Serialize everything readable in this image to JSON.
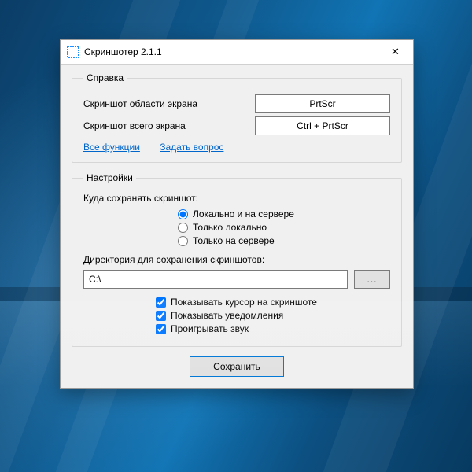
{
  "window": {
    "title": "Скриншотер 2.1.1"
  },
  "help": {
    "legend": "Справка",
    "area_label": "Скриншот области экрана",
    "area_hotkey": "PrtScr",
    "full_label": "Скриншот всего экрана",
    "full_hotkey": "Ctrl + PrtScr",
    "link_all": "Все функции",
    "link_ask": "Задать вопрос"
  },
  "settings": {
    "legend": "Настройки",
    "save_where_label": "Куда сохранять скриншот:",
    "radios": {
      "both": "Локально и на сервере",
      "local": "Только локально",
      "server": "Только на сервере",
      "selected": "both"
    },
    "dir_label": "Директория для сохранения скриншотов:",
    "dir_value": "C:\\",
    "browse_label": "...",
    "checks": {
      "cursor": {
        "label": "Показывать курсор на скриншоте",
        "checked": true
      },
      "notify": {
        "label": "Показывать уведомления",
        "checked": true
      },
      "sound": {
        "label": "Проигрывать звук",
        "checked": true
      }
    }
  },
  "save_button": "Сохранить"
}
